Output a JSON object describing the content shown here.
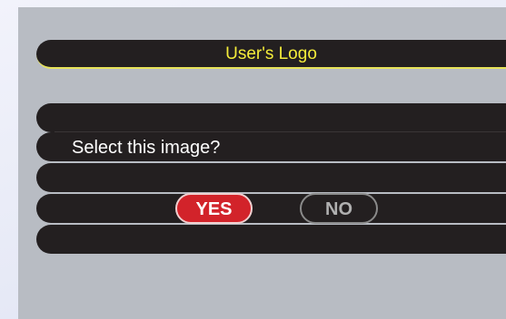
{
  "dialog": {
    "title": "User's Logo",
    "prompt": "Select this image?",
    "yes_label": "YES",
    "no_label": "NO"
  },
  "colors": {
    "title_text": "#f4ec3a",
    "panel_bg": "#b8bcc3",
    "bar_bg": "#231f20",
    "yes_bg": "#d2232a"
  }
}
